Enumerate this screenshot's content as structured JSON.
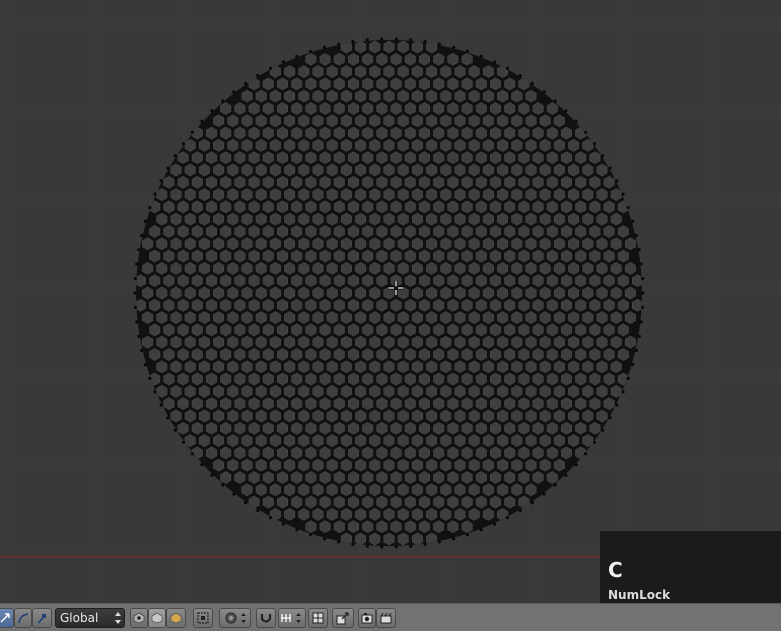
{
  "viewport": {
    "object": "honeycomb-disc-mesh",
    "cursor_icon": "3d-cursor-icon",
    "colors": {
      "background": "#393939",
      "grid": "#3f3f3f",
      "mesh_fill": "#111111",
      "cell_fill": "#3e3e3e",
      "axis_line": "#8a2a2a"
    }
  },
  "keycast": {
    "key": "C",
    "modifier": "NumLock",
    "detail": "C"
  },
  "header": {
    "transform_orientation": "Global",
    "icons": [
      "translate-manipulator-icon",
      "rotate-manipulator-icon",
      "scale-manipulator-icon",
      "vertex-select-icon",
      "edge-select-icon",
      "face-select-icon",
      "occlude-geometry-icon",
      "proportional-edit-icon",
      "snap-magnet-icon",
      "snap-element-icon",
      "snap-target-icon",
      "texture-space-icon",
      "opengl-render-icon",
      "opengl-animation-icon"
    ]
  }
}
